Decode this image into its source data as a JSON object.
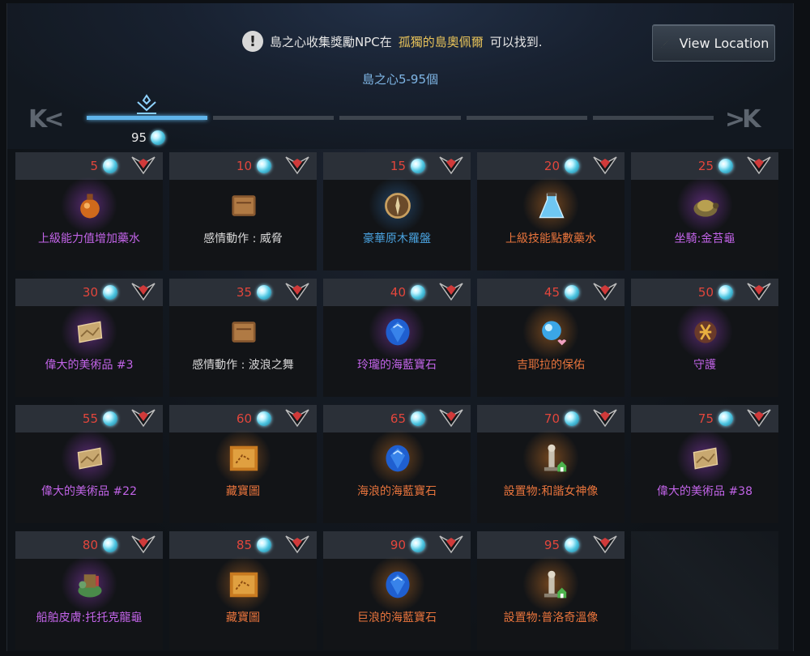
{
  "notice": {
    "text_before": "島之心收集獎勵NPC在",
    "location": "孤獨的島奧佩爾",
    "text_after": "可以找到."
  },
  "view_location_label": "View Location",
  "range_title": "島之心5-95個",
  "nav": {
    "first": "K<",
    "last": ">K"
  },
  "progress": {
    "segments": 5,
    "active_segment": 1,
    "current_count": "95"
  },
  "colors": {
    "accent_blue": "#5fb4ea",
    "required_count": "#e2463c",
    "rarity_epic": "#c264e8",
    "rarity_rare": "#4aa3e0",
    "rarity_legendary": "#e8743c",
    "rarity_common": "#d9d9d9"
  },
  "rewards": [
    {
      "count": "5",
      "name": "上級能力值增加藥水",
      "rarity": "purple",
      "icon": "potion-bottle-icon"
    },
    {
      "count": "10",
      "name": "感情動作 : 威脅",
      "rarity": "white",
      "icon": "book-icon"
    },
    {
      "count": "15",
      "name": "豪華原木羅盤",
      "rarity": "blue",
      "icon": "compass-icon"
    },
    {
      "count": "20",
      "name": "上級技能點數藥水",
      "rarity": "orange",
      "icon": "flask-icon"
    },
    {
      "count": "25",
      "name": "坐騎:金苔龜",
      "rarity": "purple",
      "icon": "turtle-mount-icon"
    },
    {
      "count": "30",
      "name": "偉大的美術品 #3",
      "rarity": "purple",
      "icon": "painting-icon"
    },
    {
      "count": "35",
      "name": "感情動作 : 波浪之舞",
      "rarity": "white",
      "icon": "book-icon"
    },
    {
      "count": "40",
      "name": "玲瓏的海藍寶石",
      "rarity": "purple",
      "icon": "aquamarine-gem-icon"
    },
    {
      "count": "45",
      "name": "吉耶拉的保佑",
      "rarity": "orange",
      "icon": "blessing-orb-icon"
    },
    {
      "count": "50",
      "name": "守護",
      "rarity": "purple",
      "icon": "rune-icon"
    },
    {
      "count": "55",
      "name": "偉大的美術品 #22",
      "rarity": "purple",
      "icon": "painting-icon"
    },
    {
      "count": "60",
      "name": "藏寶圖",
      "rarity": "orange",
      "icon": "treasure-map-icon"
    },
    {
      "count": "65",
      "name": "海浪的海藍寶石",
      "rarity": "orange",
      "icon": "aquamarine-gem-icon"
    },
    {
      "count": "70",
      "name": "設置物:和諧女神像",
      "rarity": "orange",
      "icon": "statue-icon"
    },
    {
      "count": "75",
      "name": "偉大的美術品 #38",
      "rarity": "purple",
      "icon": "painting-icon"
    },
    {
      "count": "80",
      "name": "船舶皮膚:托托克龍龜",
      "rarity": "purple",
      "icon": "ship-skin-icon"
    },
    {
      "count": "85",
      "name": "藏寶圖",
      "rarity": "orange",
      "icon": "treasure-map-icon"
    },
    {
      "count": "90",
      "name": "巨浪的海藍寶石",
      "rarity": "orange",
      "icon": "aquamarine-gem-icon"
    },
    {
      "count": "95",
      "name": "設置物:普洛奇溫像",
      "rarity": "orange",
      "icon": "statue-icon"
    }
  ]
}
